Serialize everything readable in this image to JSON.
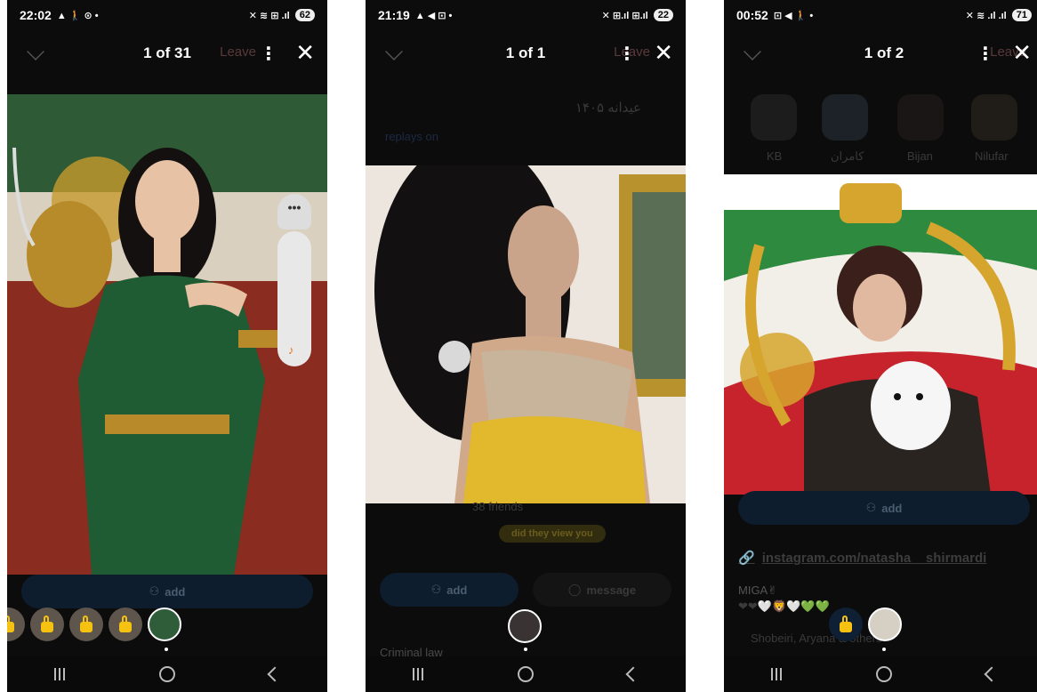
{
  "screens": [
    {
      "status": {
        "time": "22:02",
        "left_icons": "▲ 🚶 ⊙ •",
        "right_icons": "✕ ≋ ⊞ .ıl",
        "battery": "62"
      },
      "counter": "1 of 31",
      "ghost_leave": "Leave",
      "add_label": "add",
      "thumbs_locked": 4,
      "side_dots": "•••"
    },
    {
      "status": {
        "time": "21:19",
        "left_icons": "▲ ◀ ⊡ •",
        "right_icons": "✕ ⊞.ıl ⊞.ıl",
        "battery": "22"
      },
      "counter": "1 of 1",
      "ghost_leave": "Leave",
      "bg_arabic": "عیدانه ۱۴۰۵",
      "bg_link": "replays on",
      "bg_friends": "38 friends",
      "pill": "did they view you",
      "add_label": "add",
      "message_label": "message",
      "footer_text": "Criminal law"
    },
    {
      "status": {
        "time": "00:52",
        "left_icons": "⊡ ◀ 🚶 •",
        "right_icons": "✕ ≋ .ıl .ıl",
        "battery": "71"
      },
      "counter": "1 of 2",
      "ghost_leave": "Leave",
      "friends": [
        "KB",
        "کامران",
        "Bijan",
        "Nilufar"
      ],
      "add_label": "add",
      "link": "instagram.com/natasha__shirmardi",
      "bio_1": "MIGA✌",
      "bio_2": "❤❤🤍🦁🤍💚💚",
      "mutuals": "Shobeiri, Aryana & others"
    }
  ],
  "colors": {
    "accent_blue": "#0d1d2e",
    "lock_yellow": "#f5c211",
    "pill_yellow": "#e9c31c"
  }
}
